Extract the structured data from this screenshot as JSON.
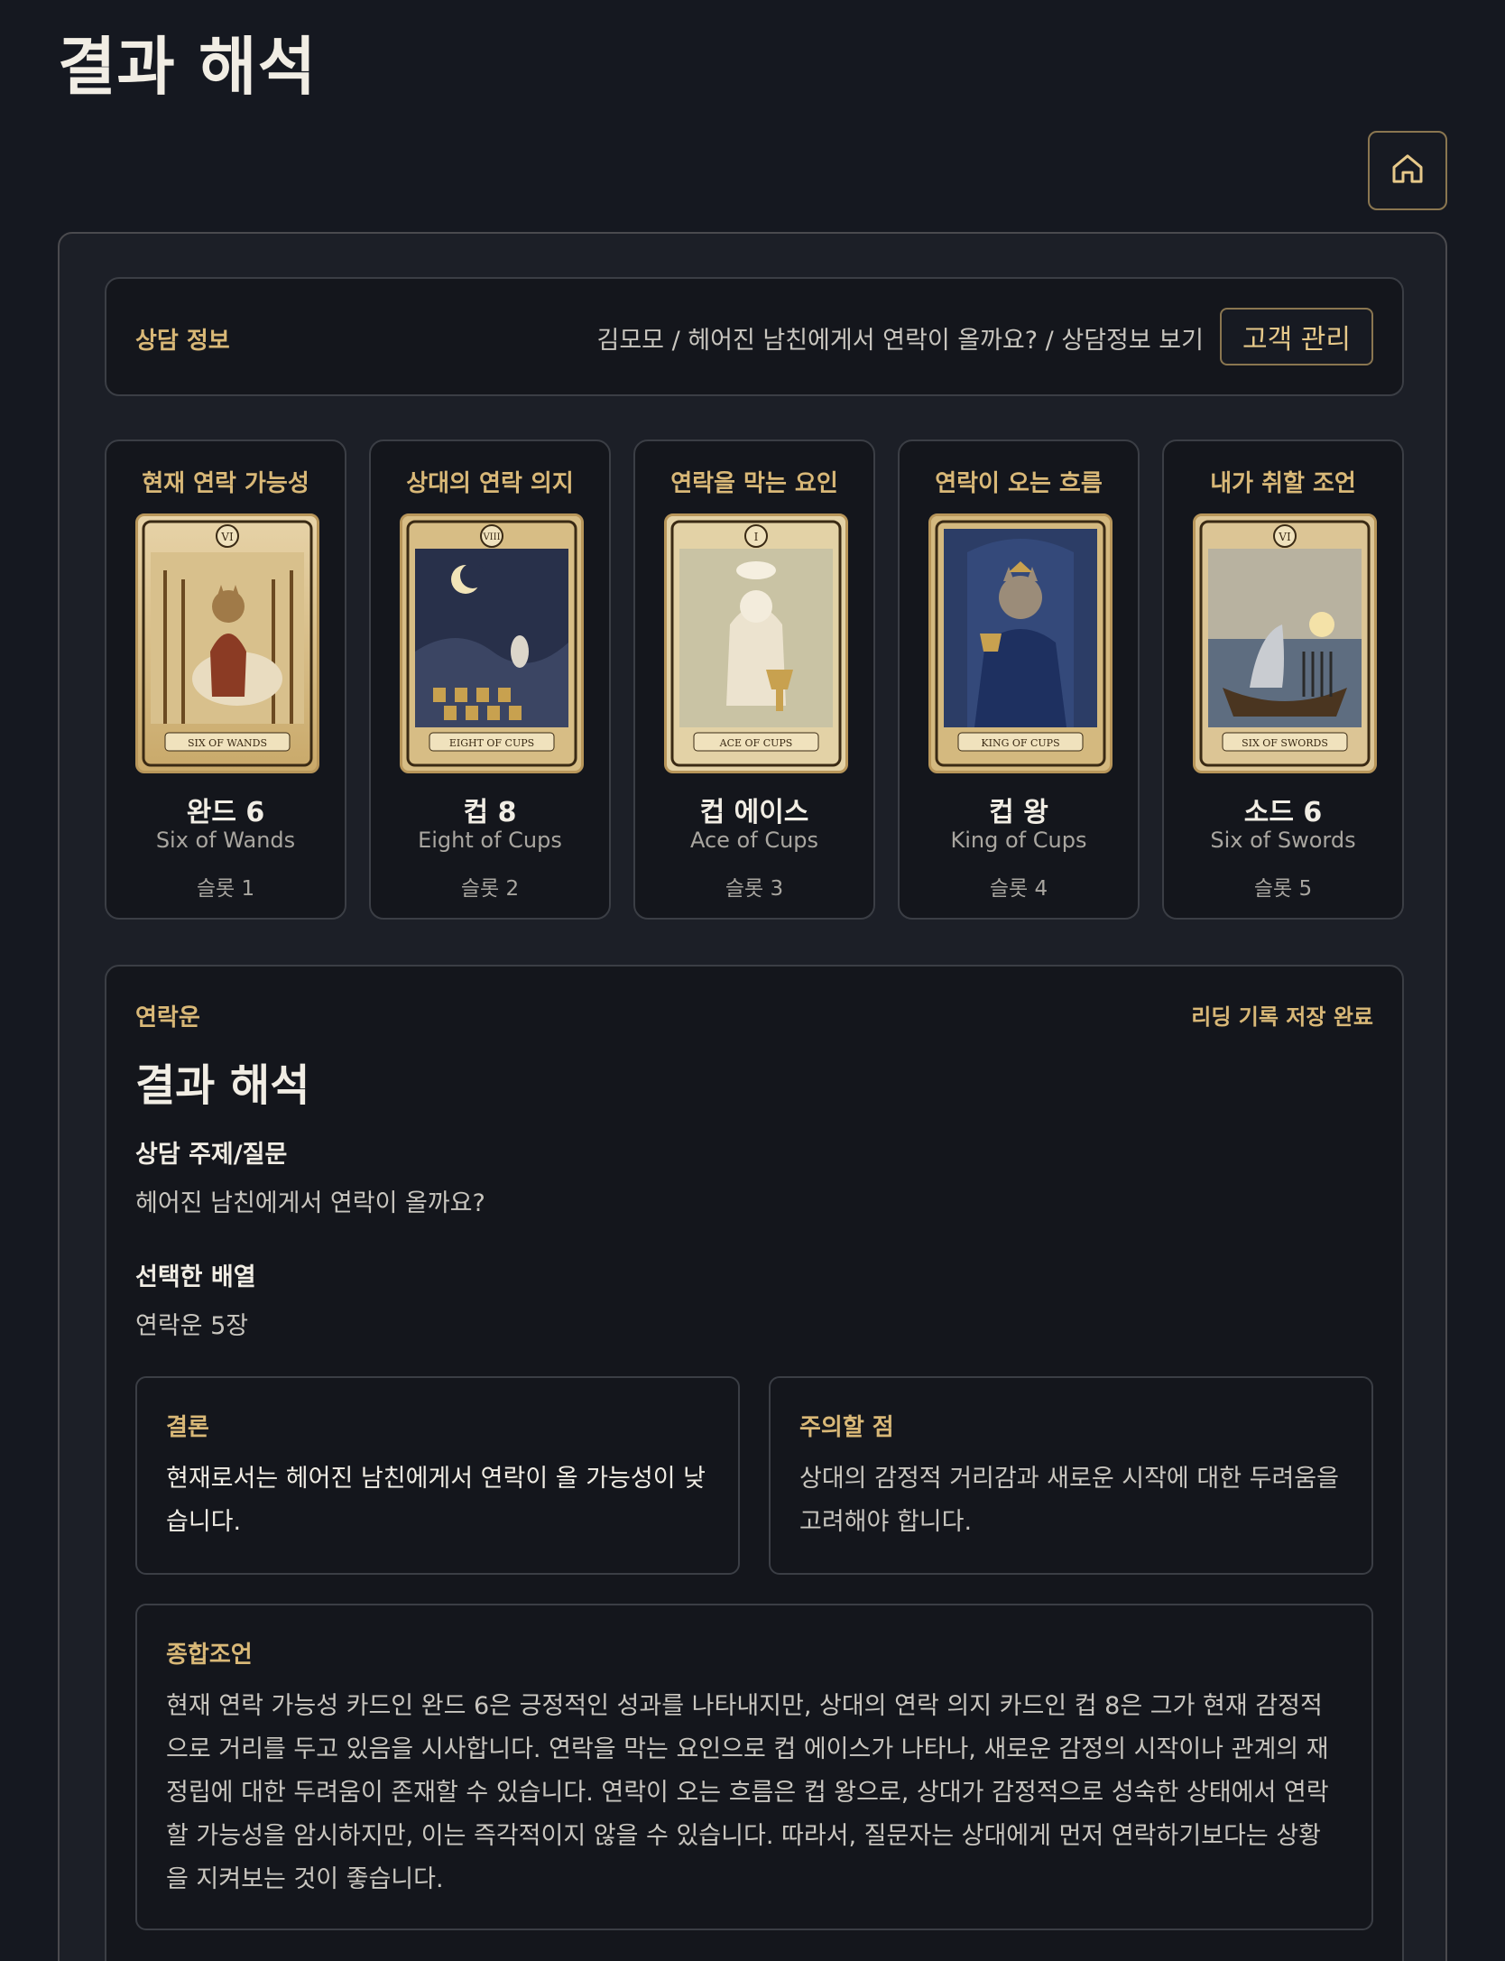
{
  "page": {
    "title": "결과 해석"
  },
  "header": {
    "home_icon": "home-icon"
  },
  "consult_info": {
    "label": "상담 정보",
    "summary": "김모모 / 헤어진 남친에게서 연락이 올까요? / 상담정보 보기",
    "customer_button": "고객 관리"
  },
  "cards": [
    {
      "position": "현재 연락 가능성",
      "name_ko": "완드 6",
      "name_en": "Six of Wands",
      "slot": "슬롯 1",
      "numeral": "VI",
      "banner": "SIX OF WANDS"
    },
    {
      "position": "상대의 연락 의지",
      "name_ko": "컵 8",
      "name_en": "Eight of Cups",
      "slot": "슬롯 2",
      "numeral": "VIII",
      "banner": "EIGHT OF CUPS"
    },
    {
      "position": "연락을 막는 요인",
      "name_ko": "컵 에이스",
      "name_en": "Ace of Cups",
      "slot": "슬롯 3",
      "numeral": "I",
      "banner": "ACE OF CUPS"
    },
    {
      "position": "연락이 오는 흐름",
      "name_ko": "컵 왕",
      "name_en": "King of Cups",
      "slot": "슬롯 4",
      "numeral": "",
      "banner": "KING OF CUPS"
    },
    {
      "position": "내가 취할 조언",
      "name_ko": "소드 6",
      "name_en": "Six of Swords",
      "slot": "슬롯 5",
      "numeral": "VI",
      "banner": "SIX OF SWORDS"
    }
  ],
  "result": {
    "tag": "연락운",
    "saved_status": "리딩 기록 저장 완료",
    "title": "결과 해석",
    "question_label": "상담 주제/질문",
    "question": "헤어진 남친에게서 연락이 올까요?",
    "spread_label": "선택한 배열",
    "spread": "연락운 5장",
    "conclusion_label": "결론",
    "conclusion": "현재로서는 헤어진 남친에게서 연락이 올 가능성이 낮습니다.",
    "caution_label": "주의할 점",
    "caution": "상대의 감정적 거리감과 새로운 시작에 대한 두려움을 고려해야 합니다.",
    "advice_label": "종합조언",
    "advice": "현재 연락 가능성 카드인 완드 6은 긍정적인 성과를 나타내지만, 상대의 연락 의지 카드인 컵 8은 그가 현재 감정적으로 거리를 두고 있음을 시사합니다. 연락을 막는 요인으로 컵 에이스가 나타나, 새로운 감정의 시작이나 관계의 재정립에 대한 두려움이 존재할 수 있습니다. 연락이 오는 흐름은 컵 왕으로, 상대가 감정적으로 성숙한 상태에서 연락할 가능성을 암시하지만, 이는 즉각적이지 않을 수 있습니다. 따라서, 질문자는 상대에게 먼저 연락하기보다는 상황을 지켜보는 것이 좋습니다."
  },
  "colors": {
    "accent": "#d9b877",
    "background": "#151820",
    "panel": "#1c1f27",
    "box": "#14161c",
    "border": "#3b3e45"
  }
}
